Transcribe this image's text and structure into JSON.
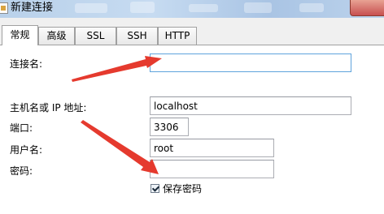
{
  "window": {
    "title": "新建连接"
  },
  "tabs": [
    {
      "label": "常规",
      "active": true
    },
    {
      "label": "高级",
      "active": false
    },
    {
      "label": "SSL",
      "active": false
    },
    {
      "label": "SSH",
      "active": false
    },
    {
      "label": "HTTP",
      "active": false
    }
  ],
  "form": {
    "connection_name": {
      "label": "连接名:",
      "value": ""
    },
    "host": {
      "label": "主机名或 IP 地址:",
      "value": "localhost"
    },
    "port": {
      "label": "端口:",
      "value": "3306"
    },
    "username": {
      "label": "用户名:",
      "value": "root"
    },
    "password": {
      "label": "密码:",
      "value": ""
    },
    "save_password": {
      "label": "保存密码",
      "checked": true
    }
  },
  "annotations": {
    "arrow_color": "#e53a2e"
  },
  "colors": {
    "titlebar": "#c6dbf1",
    "close_button": "#c75050",
    "panel_bg": "#ffffff",
    "window_bg": "#f0f0f0"
  }
}
